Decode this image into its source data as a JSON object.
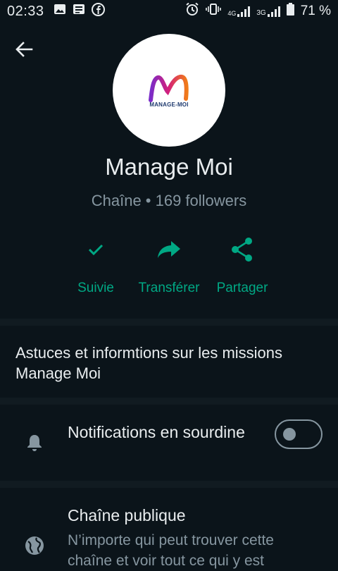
{
  "status_bar": {
    "time": "02:33",
    "network_4g": "4G",
    "network_3g": "3G",
    "battery": "71 %"
  },
  "channel": {
    "name": "Manage Moi",
    "subtitle": "Chaîne • 169 followers",
    "logo_text": "MANAGE-MOI"
  },
  "actions": [
    {
      "label": "Suivie",
      "icon": "check-icon"
    },
    {
      "label": "Transférer",
      "icon": "forward-icon"
    },
    {
      "label": "Partager",
      "icon": "share-icon"
    }
  ],
  "description": "Astuces et informtions sur les missions Manage Moi",
  "notifications": {
    "title": "Notifications en sourdine",
    "muted": false,
    "icon": "bell-icon"
  },
  "public_channel": {
    "title": "Chaîne publique",
    "subtitle": "N’importe qui peut trouver cette chaîne et voir tout ce qui y est",
    "icon": "globe-icon"
  },
  "colors": {
    "background": "#0b141a",
    "accent": "#00a884",
    "secondary_text": "#8696a0"
  }
}
